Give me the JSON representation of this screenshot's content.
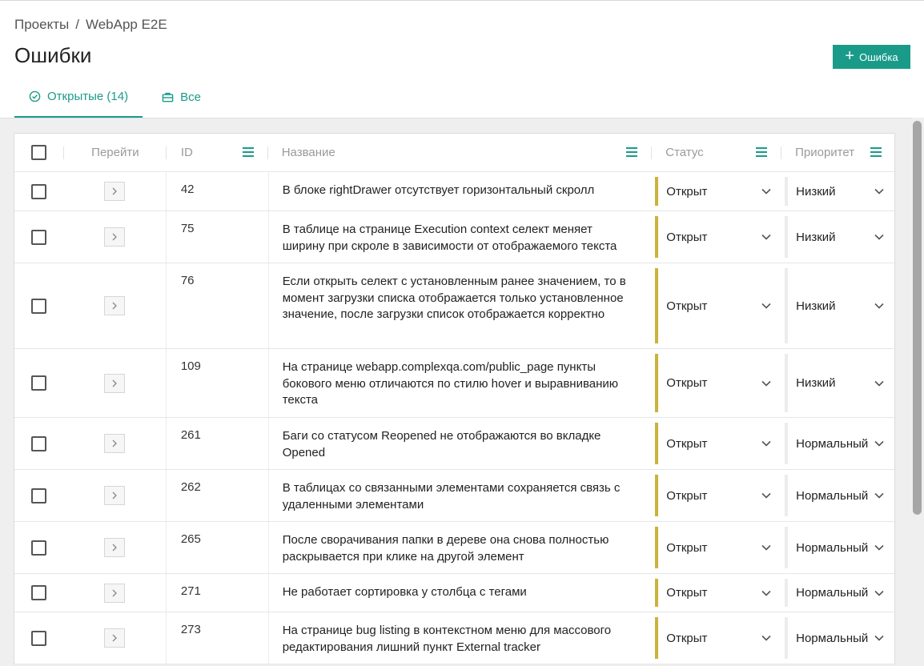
{
  "breadcrumb": {
    "project": "Проекты",
    "separator": "/",
    "current": "WebApp E2E"
  },
  "page_title": "Ошибки",
  "add_button": {
    "label": "Ошибка",
    "icon": "plus-icon"
  },
  "tabs": [
    {
      "label": "Открытые (14)",
      "icon": "check-circle-icon",
      "active": true
    },
    {
      "label": "Все",
      "icon": "briefcase-icon",
      "active": false
    }
  ],
  "table": {
    "columns": {
      "go": "Перейти",
      "id": "ID",
      "name": "Название",
      "status": "Статус",
      "priority": "Приоритет"
    },
    "rows": [
      {
        "id": "42",
        "name": "В блоке rightDrawer отсутствует горизонтальный скролл",
        "status": "Открыт",
        "priority": "Низкий"
      },
      {
        "id": "75",
        "name": "В таблице на странице Execution context селект меняет ширину при скроле в зависимости от отображаемого текста",
        "status": "Открыт",
        "priority": "Низкий"
      },
      {
        "id": "76",
        "name": "Если открыть селект с установленным ранее значением, то в момент загрузки списка отображается только установленное значение, после загрузки список отображается корректно",
        "status": "Открыт",
        "priority": "Низкий"
      },
      {
        "id": "109",
        "name": "На странице webapp.complexqa.com/public_page пункты бокового меню отличаются по стилю hover и выравниванию текста",
        "status": "Открыт",
        "priority": "Низкий"
      },
      {
        "id": "261",
        "name": "Баги со статусом Reopened не отображаются во вкладке Opened",
        "status": "Открыт",
        "priority": "Нормальный"
      },
      {
        "id": "262",
        "name": "В таблицах со связанными элементами сохраняется связь с удаленными элементами",
        "status": "Открыт",
        "priority": "Нормальный"
      },
      {
        "id": "265",
        "name": "После сворачивания папки в дереве она снова полностью раскрывается при клике на другой элемент",
        "status": "Открыт",
        "priority": "Нормальный"
      },
      {
        "id": "271",
        "name": "Не работает сортировка у столбца с тегами",
        "status": "Открыт",
        "priority": "Нормальный"
      },
      {
        "id": "273",
        "name": "На странице bug listing в контекстном меню для массового редактирования лишний пункт External tracker",
        "status": "Открыт",
        "priority": "Нормальный"
      }
    ]
  },
  "colors": {
    "accent": "#1a9b8a",
    "status_open": "#c9b33c"
  }
}
